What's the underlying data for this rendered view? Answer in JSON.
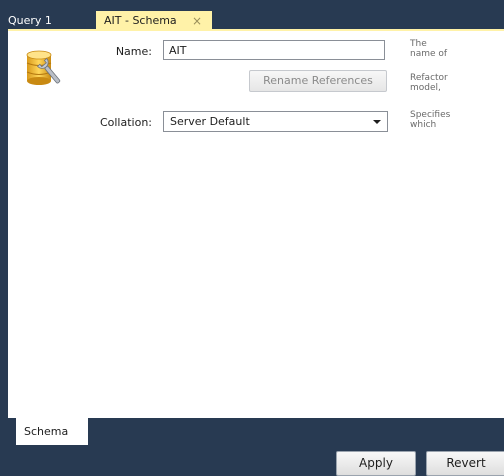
{
  "tabs": [
    {
      "label": "Query 1",
      "active": false
    },
    {
      "label": "AIT - Schema",
      "active": true,
      "close_glyph": "×"
    }
  ],
  "editor": {
    "icon": "database-wrench-icon",
    "name_label": "Name:",
    "name_value": "AIT",
    "rename_button": "Rename References",
    "collation_label": "Collation:",
    "collation_value": "Server Default",
    "hints": [
      "The\nname of",
      "Refactor\nmodel,",
      "Specifies\nwhich"
    ]
  },
  "bottom_tabs": [
    {
      "label": "Schema"
    }
  ],
  "footer": {
    "apply_label": "Apply",
    "revert_label": "Revert"
  },
  "colors": {
    "chrome": "#283a52",
    "active_tab": "#fff2a8",
    "panel": "#ffffff"
  }
}
